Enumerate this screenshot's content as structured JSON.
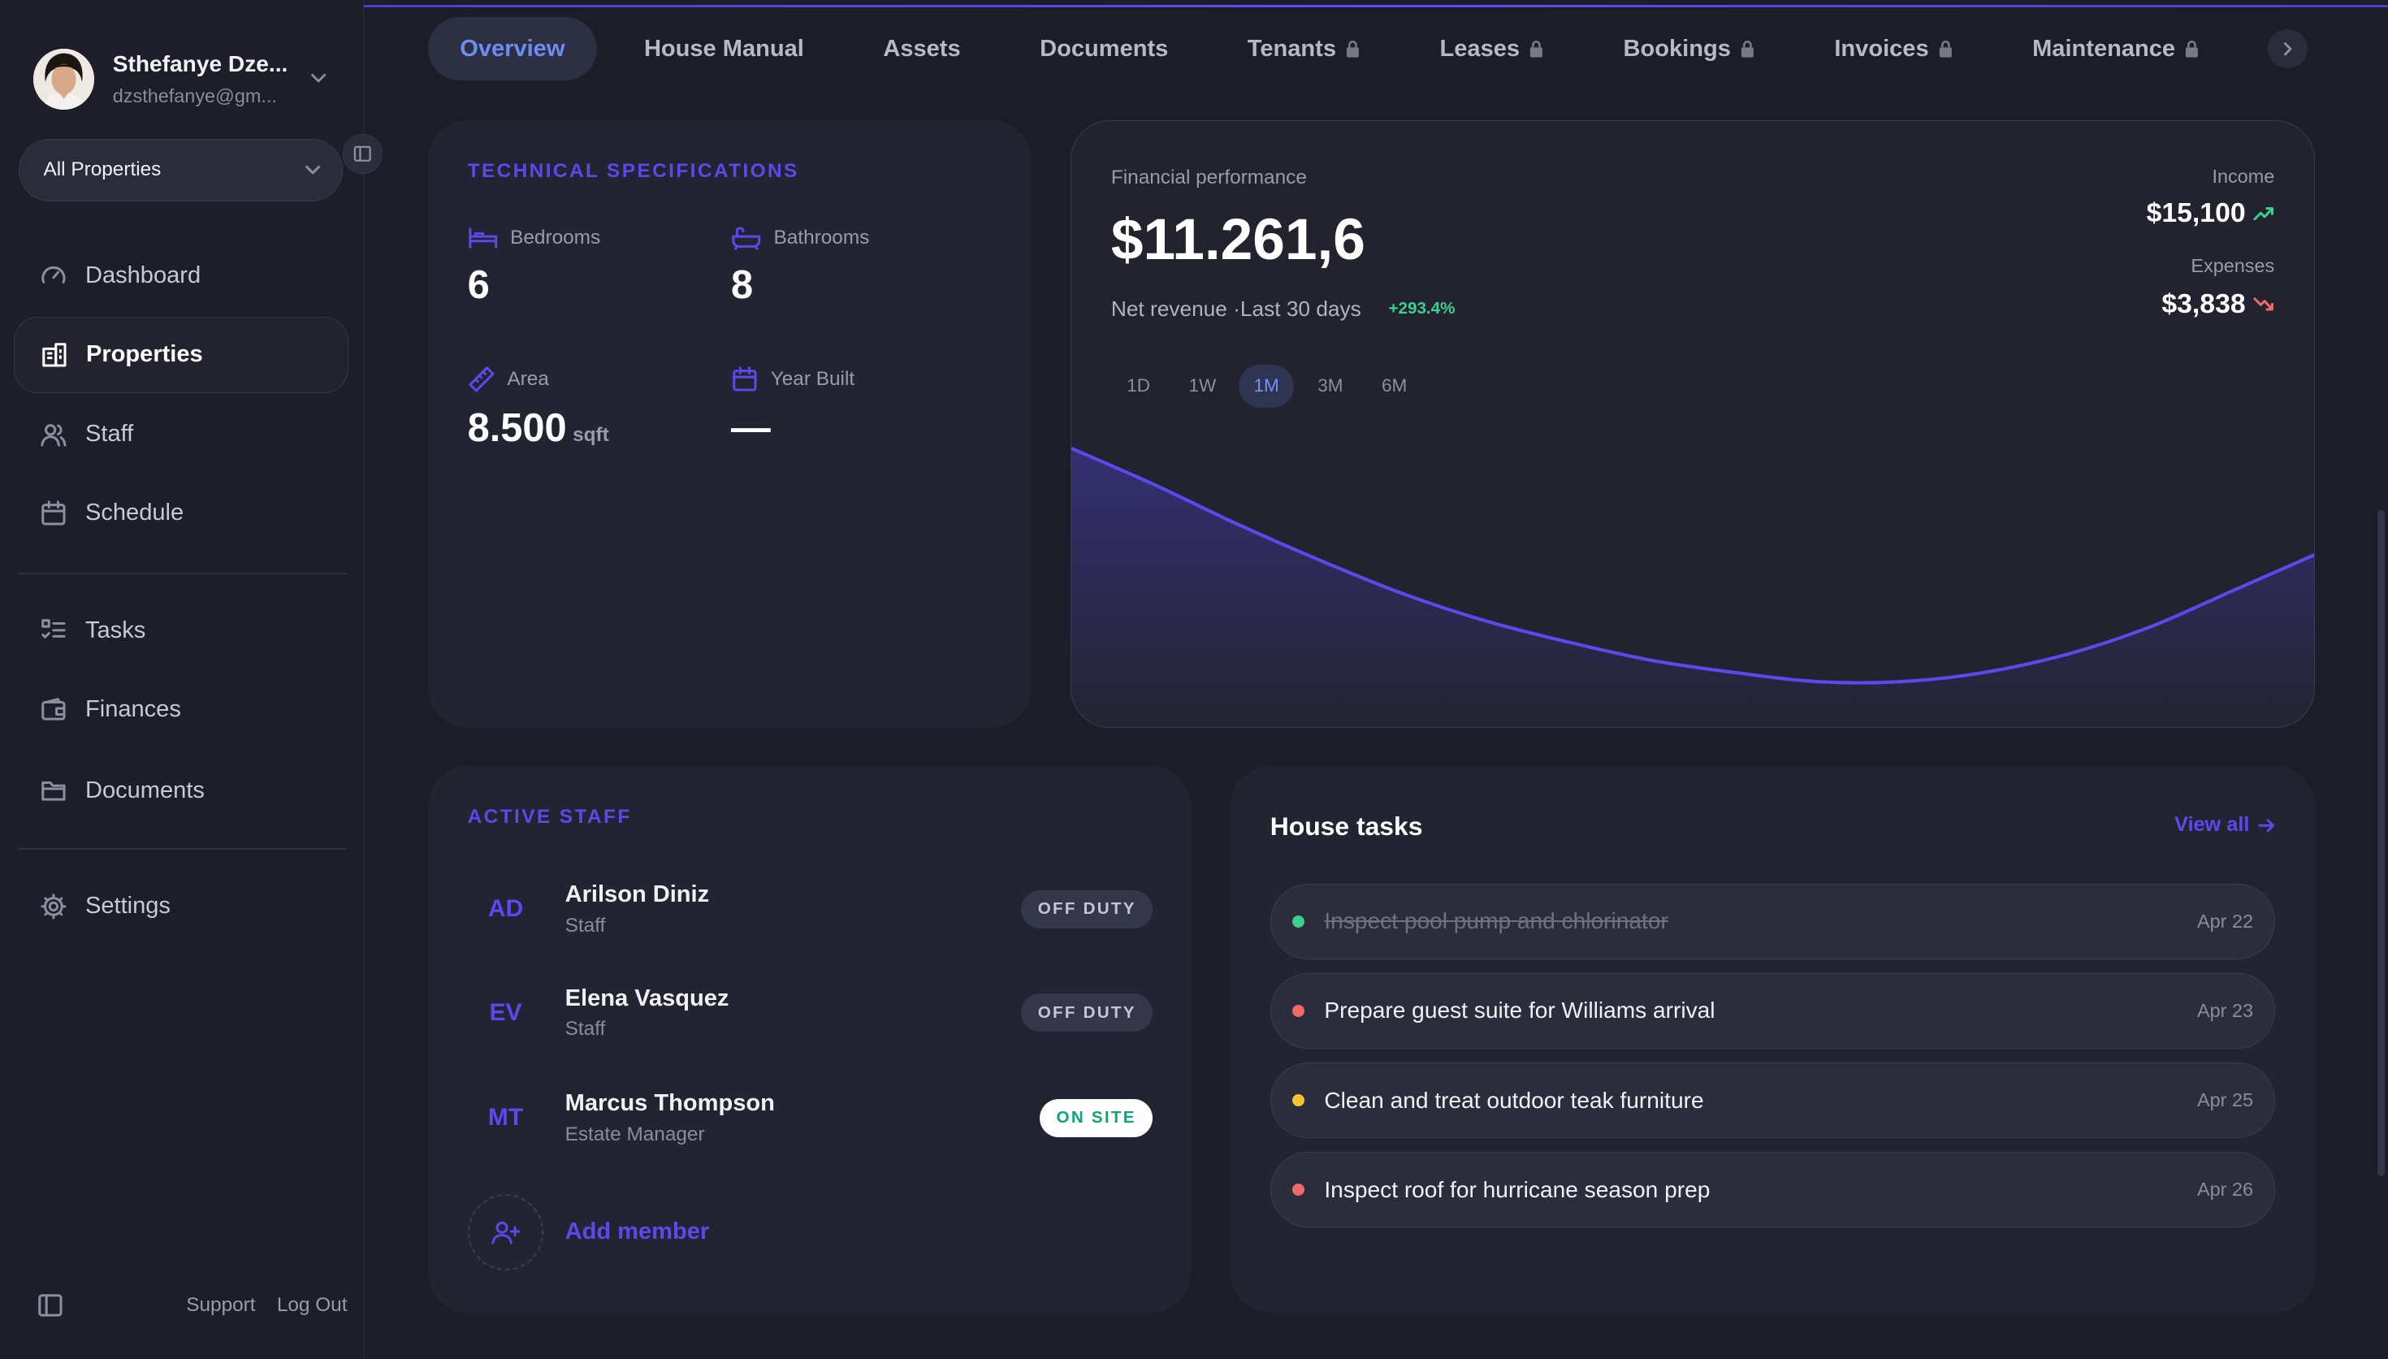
{
  "user": {
    "name": "Sthefanye Dze...",
    "email": "dzsthefanye@gm..."
  },
  "property_selector": {
    "value": "All Properties"
  },
  "sidebar": {
    "items": [
      {
        "label": "Dashboard"
      },
      {
        "label": "Properties"
      },
      {
        "label": "Staff"
      },
      {
        "label": "Schedule"
      },
      {
        "label": "Tasks"
      },
      {
        "label": "Finances"
      },
      {
        "label": "Documents"
      },
      {
        "label": "Settings"
      }
    ],
    "support": "Support",
    "logout": "Log Out"
  },
  "tabs": [
    {
      "label": "Overview",
      "locked": false
    },
    {
      "label": "House Manual",
      "locked": false
    },
    {
      "label": "Assets",
      "locked": false
    },
    {
      "label": "Documents",
      "locked": false
    },
    {
      "label": "Tenants",
      "locked": true
    },
    {
      "label": "Leases",
      "locked": true
    },
    {
      "label": "Bookings",
      "locked": true
    },
    {
      "label": "Invoices",
      "locked": true
    },
    {
      "label": "Maintenance",
      "locked": true
    }
  ],
  "tech": {
    "title": "TECHNICAL SPECIFICATIONS",
    "bedrooms": {
      "label": "Bedrooms",
      "value": "6"
    },
    "bathrooms": {
      "label": "Bathrooms",
      "value": "8"
    },
    "area": {
      "label": "Area",
      "value": "8.500",
      "unit": "sqft"
    },
    "year_built": {
      "label": "Year Built",
      "value": "—"
    }
  },
  "finance": {
    "label": "Financial performance",
    "amount": "$11.261,6",
    "sub": "Net revenue ·Last 30 days",
    "change": "+293.4%",
    "income_label": "Income",
    "income": "$15,100",
    "expenses_label": "Expenses",
    "expenses": "$3,838",
    "ranges": [
      "1D",
      "1W",
      "1M",
      "3M",
      "6M"
    ],
    "active_range": "1M",
    "accent": "#5b49ee",
    "chart_data": {
      "type": "area",
      "values": [
        0.92,
        0.8,
        0.67,
        0.55,
        0.44,
        0.35,
        0.28,
        0.22,
        0.18,
        0.15,
        0.15,
        0.18,
        0.24,
        0.33,
        0.45,
        0.57
      ],
      "ylim": [
        0,
        1
      ]
    }
  },
  "staff": {
    "title": "ACTIVE STAFF",
    "members": [
      {
        "initials": "AD",
        "name": "Arilson Diniz",
        "role": "Staff",
        "status": "OFF DUTY"
      },
      {
        "initials": "EV",
        "name": "Elena Vasquez",
        "role": "Staff",
        "status": "OFF DUTY"
      },
      {
        "initials": "MT",
        "name": "Marcus Thompson",
        "role": "Estate Manager",
        "status": "ON SITE"
      }
    ],
    "add_label": "Add member"
  },
  "tasks": {
    "title": "House tasks",
    "view_all": "View all",
    "items": [
      {
        "text": "Inspect pool pump and chlorinator",
        "date": "Apr 22",
        "done": true,
        "color": "#3ccf8e"
      },
      {
        "text": "Prepare guest suite for Williams arrival",
        "date": "Apr 23",
        "done": false,
        "color": "#f06a6a"
      },
      {
        "text": "Clean and treat outdoor teak furniture",
        "date": "Apr 25",
        "done": false,
        "color": "#f5c431"
      },
      {
        "text": "Inspect roof for hurricane season prep",
        "date": "Apr 26",
        "done": false,
        "color": "#f06a6a"
      }
    ]
  }
}
